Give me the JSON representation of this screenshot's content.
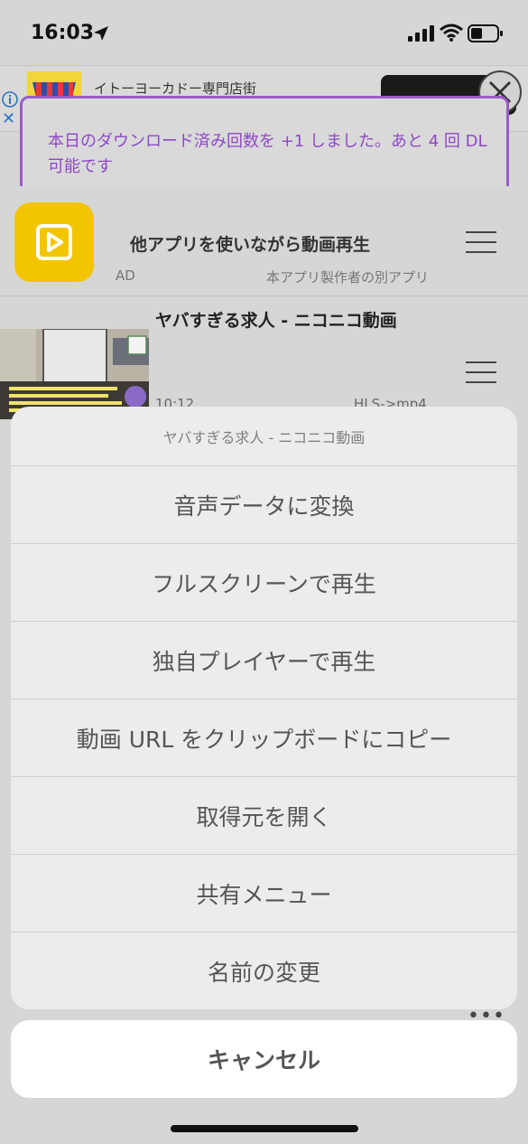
{
  "status_bar": {
    "time": "16:03"
  },
  "ad_banner": {
    "store_name": "イトーヨーカドー専門店街"
  },
  "toast": {
    "message": "本日のダウンロード済み回数を +1 しました。あと 4 回 DL 可能です"
  },
  "ad_app": {
    "title": "他アプリを使いながら動画再生",
    "ad_label": "AD",
    "subtitle": "本アプリ製作者の別アプリ"
  },
  "video": {
    "title": "ヤバすぎる求人 - ニコニコ動画",
    "duration": "10:12",
    "format": "HLS->mp4"
  },
  "action_sheet": {
    "title": "ヤバすぎる求人 - ニコニコ動画",
    "actions": [
      "音声データに変換",
      "フルスクリーンで再生",
      "独自プレイヤーで再生",
      "動画 URL をクリップボードにコピー",
      "取得元を開く",
      "共有メニュー",
      "名前の変更"
    ],
    "cancel": "キャンセル"
  }
}
